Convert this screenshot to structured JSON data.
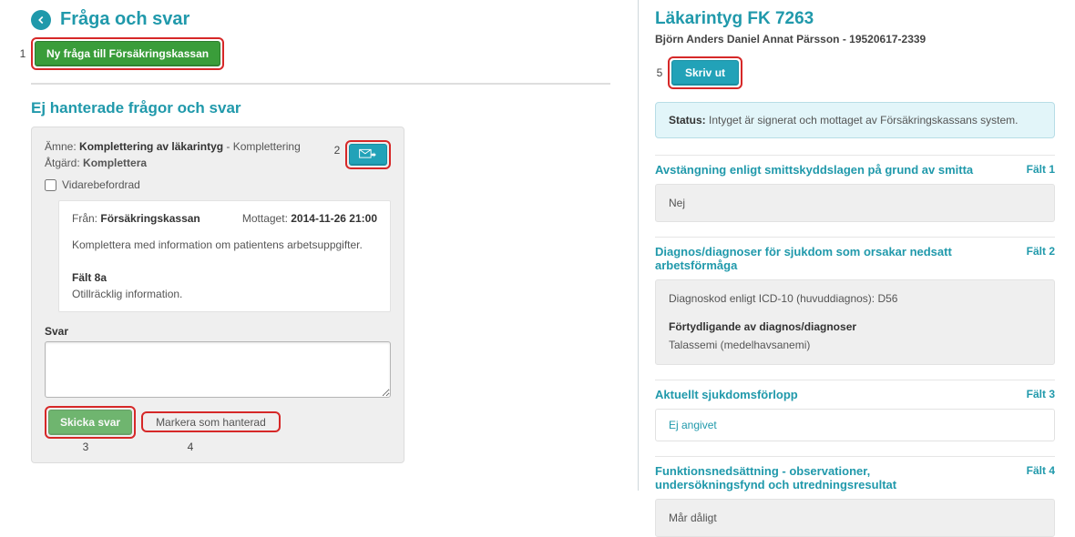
{
  "left": {
    "title": "Fråga och svar",
    "new_question_btn": "Ny fråga till Försäkringskassan",
    "sub_heading": "Ej hanterade frågor och svar",
    "card": {
      "subject_label": "Ämne:",
      "subject_value": "Komplettering av läkarintyg",
      "subject_tag": " - Komplettering",
      "action_label": "Åtgärd:",
      "action_value": "Komplettera",
      "forward_label": "Vidarebefordrad",
      "from_label": "Från:",
      "from_value": "Försäkringskassan",
      "received_label": "Mottaget:",
      "received_value": "2014-11-26 21:00",
      "message_body": "Komplettera med information om patientens arbetsuppgifter.",
      "field_label": "Fält 8a",
      "field_text": "Otillräcklig information.",
      "reply_label": "Svar",
      "send_btn": "Skicka svar",
      "mark_handled_btn": "Markera som hanterad"
    },
    "annotations": {
      "one": "1",
      "two": "2",
      "three": "3",
      "four": "4"
    }
  },
  "right": {
    "title": "Läkarintyg FK 7263",
    "patient": "Björn Anders Daniel Annat Pärsson - 19520617-2339",
    "print_btn": "Skriv ut",
    "annotation_five": "5",
    "status_label": "Status:",
    "status_text": " Intyget är signerat och mottaget av Försäkringskassans system.",
    "sections": [
      {
        "title": "Avstängning enligt smittskyddslagen på grund av smitta",
        "badge": "Fält 1",
        "type": "plain",
        "body": "Nej"
      },
      {
        "title": "Diagnos/diagnoser för sjukdom som orsakar nedsatt arbetsförmåga",
        "badge": "Fält 2",
        "type": "diagnosis",
        "diag_text": "Diagnoskod enligt ICD-10 (huvuddiagnos): D56",
        "sub_label": "Förtydligande av diagnos/diagnoser",
        "sub_text": "Talassemi (medelhavsanemi)"
      },
      {
        "title": "Aktuellt sjukdomsförlopp",
        "badge": "Fält 3",
        "type": "empty",
        "body": "Ej angivet"
      },
      {
        "title": "Funktionsnedsättning - observationer, undersökningsfynd och utredningsresultat",
        "badge": "Fält 4",
        "type": "plain",
        "body": "Mår dåligt"
      }
    ]
  }
}
